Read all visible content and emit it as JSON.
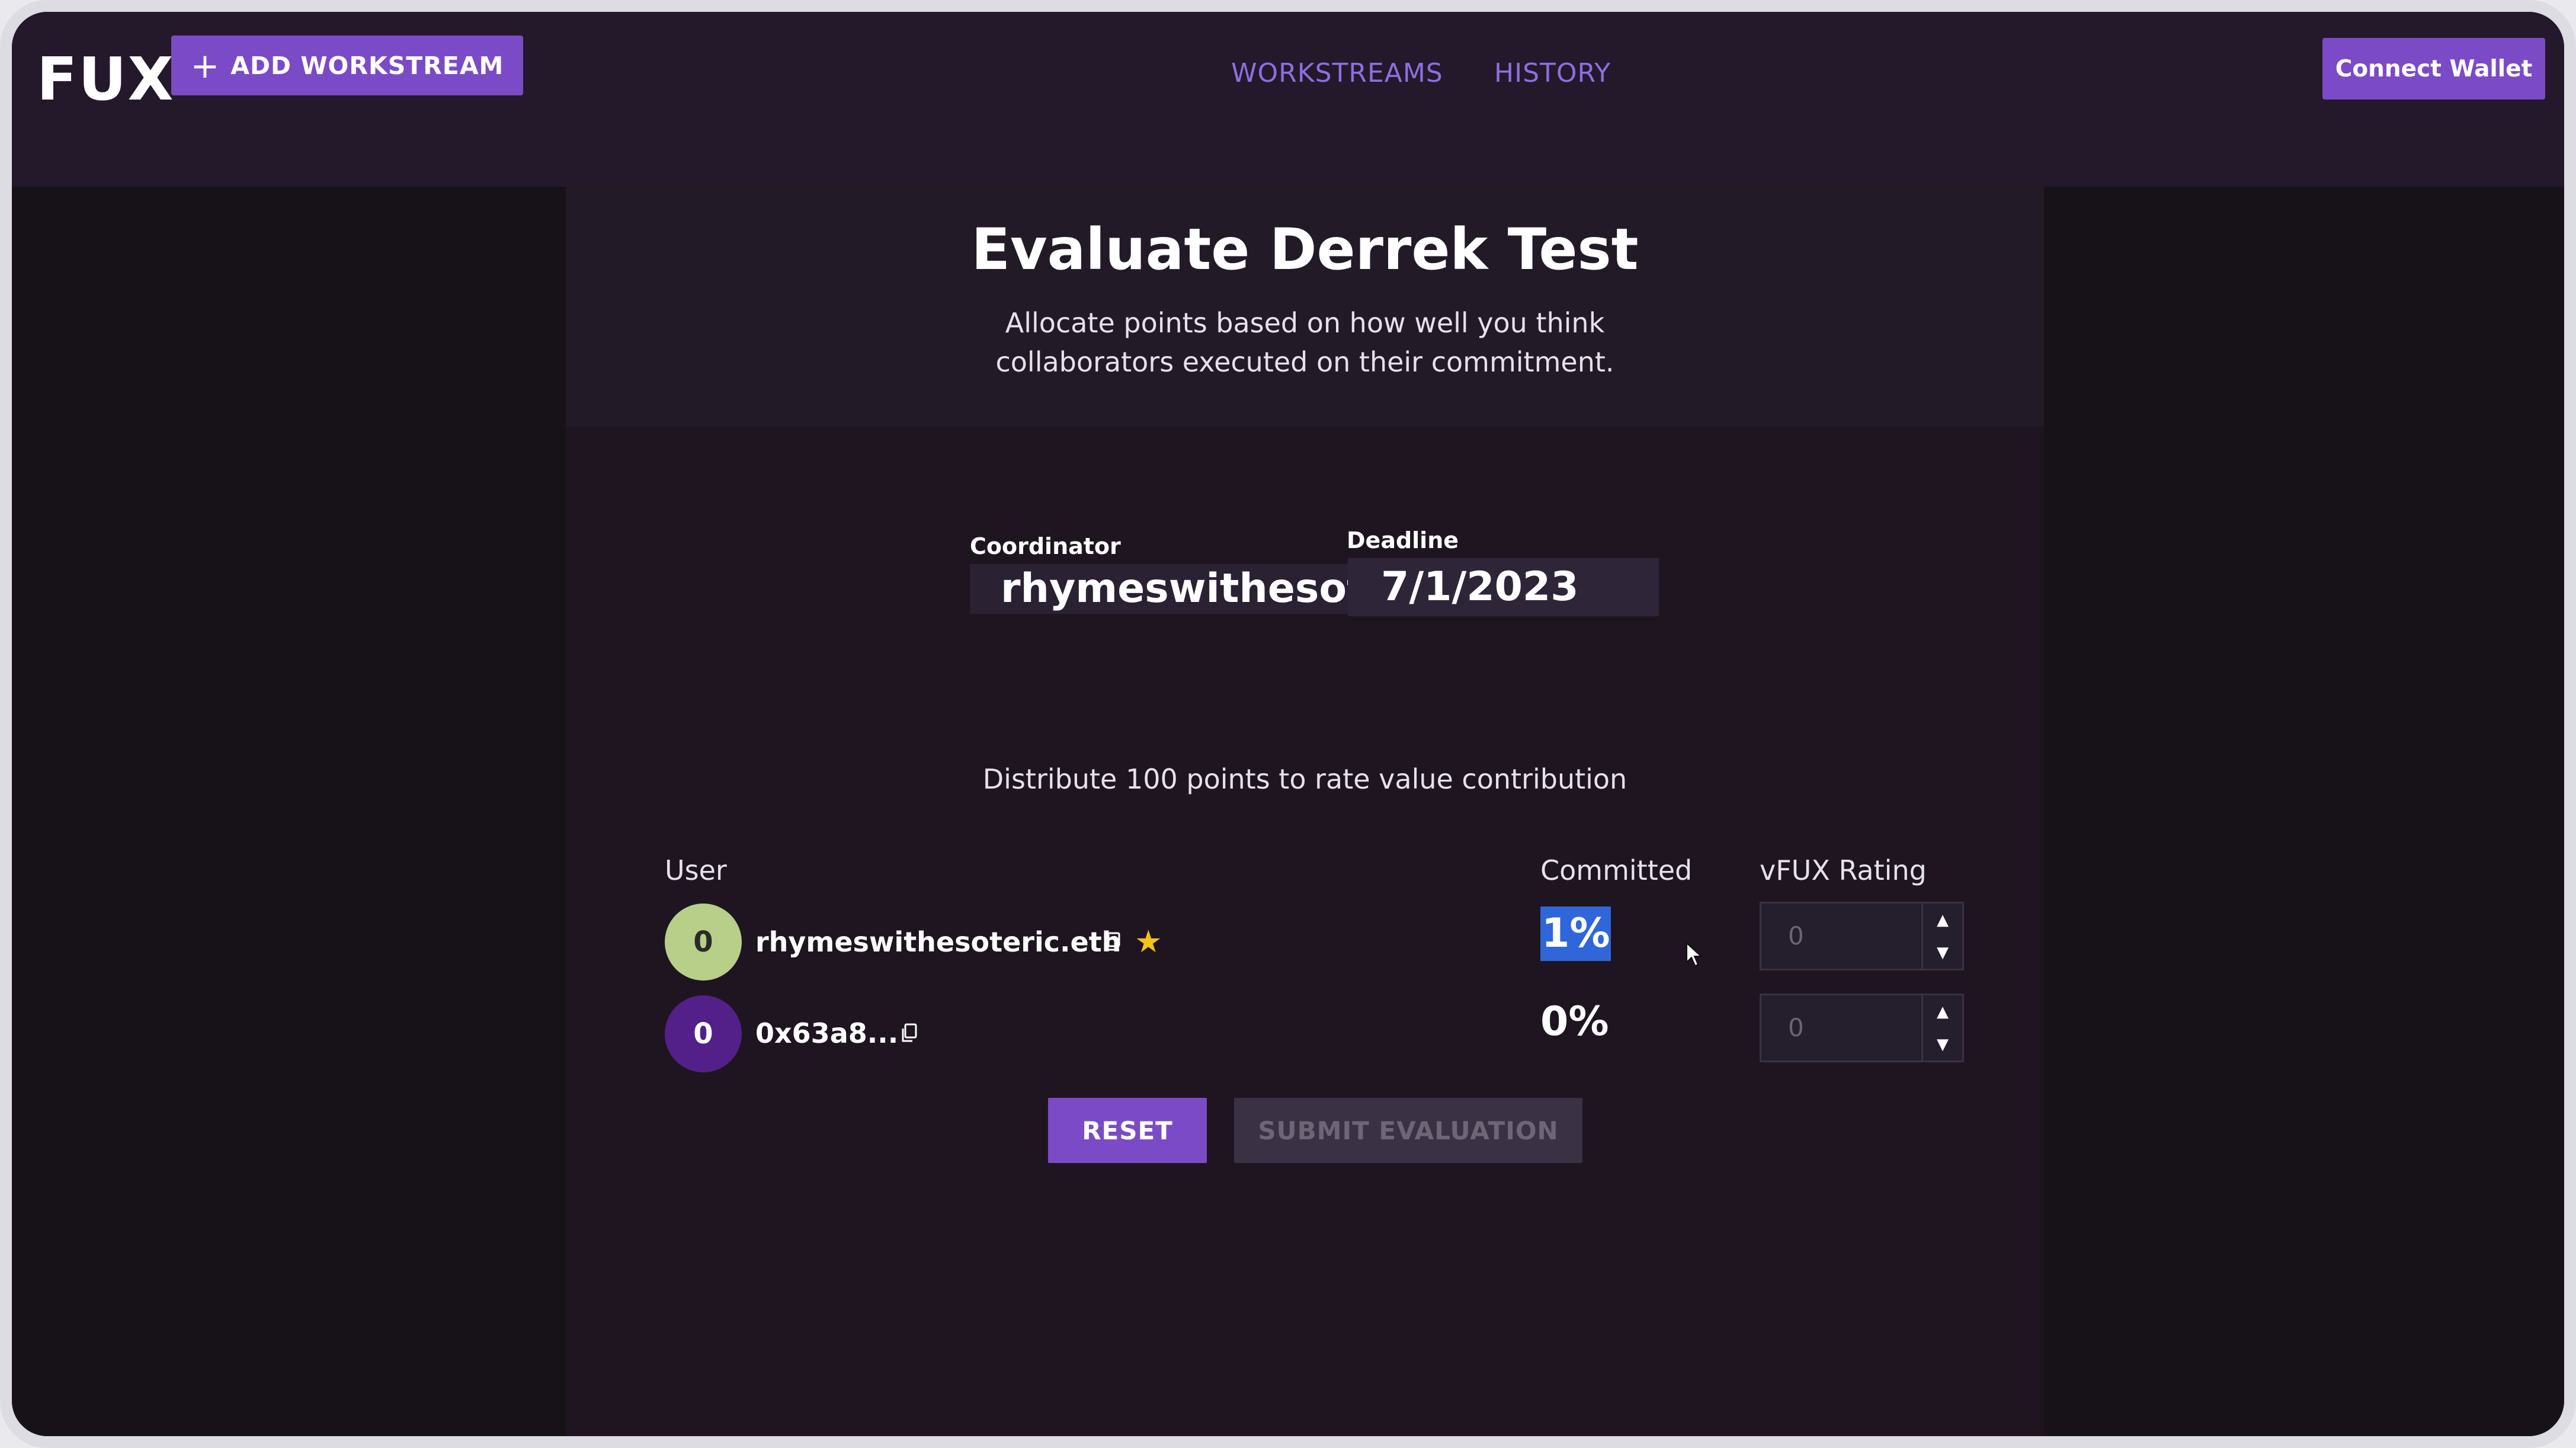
{
  "header": {
    "logo": "FUX",
    "add_workstream_label": "ADD WORKSTREAM",
    "nav": [
      "WORKSTREAMS",
      "HISTORY"
    ],
    "connect_wallet_label": "Connect Wallet"
  },
  "page": {
    "title": "Evaluate Derrek Test",
    "subtitle_line1": "Allocate points based on how well you think",
    "subtitle_line2": "collaborators executed on their commitment.",
    "coordinator_label": "Coordinator",
    "coordinator_value": "rhymeswithesoteric.eth",
    "deadline_label": "Deadline",
    "deadline_value": "7/1/2023",
    "distribute_text": "Distribute 100 points to rate value contribution"
  },
  "table": {
    "headers": [
      "User",
      "Committed",
      "vFUX Rating"
    ],
    "rows": [
      {
        "avatar_text": "0",
        "name": "rhymeswithesoteric.eth",
        "committed": "1%",
        "rating": "0",
        "coordinator": true
      },
      {
        "avatar_text": "0",
        "name": "0x63a8...",
        "committed": "0%",
        "rating": "0",
        "coordinator": false
      }
    ]
  },
  "actions": {
    "reset_label": "RESET",
    "submit_label": "SUBMIT EVALUATION"
  },
  "colors": {
    "accent": "#7b4bc7",
    "nav_link": "#8d6fe0",
    "star": "#f3c319",
    "selection": "#2f67d9"
  },
  "icons": {
    "copy": "copy-icon",
    "star": "star-icon",
    "plus": "plus-icon",
    "stepper_up": "chevron-up-icon",
    "stepper_down": "chevron-down-icon"
  }
}
